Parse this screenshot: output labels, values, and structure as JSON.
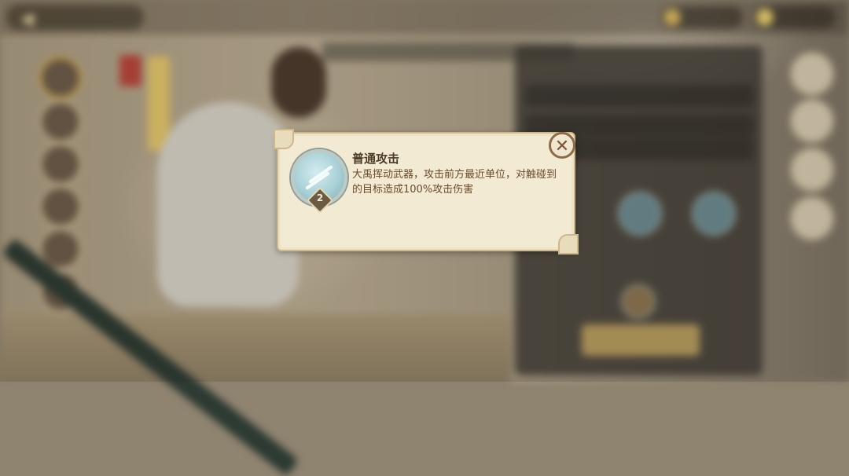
{
  "popup": {
    "skill_name": "普通攻击",
    "description": "大禹挥动武器，攻击前方最近单位，对触碰到的目标造成100%攻击伤害",
    "level": "2",
    "close_icon": "close-icon",
    "skill_icon": "twin-blades-icon"
  },
  "colors": {
    "popup_bg": "#f3ead4",
    "popup_border": "#cdb88d",
    "title_text": "#4a3a26",
    "desc_text": "#6a4a2a",
    "close_ring": "#8d6a48"
  }
}
